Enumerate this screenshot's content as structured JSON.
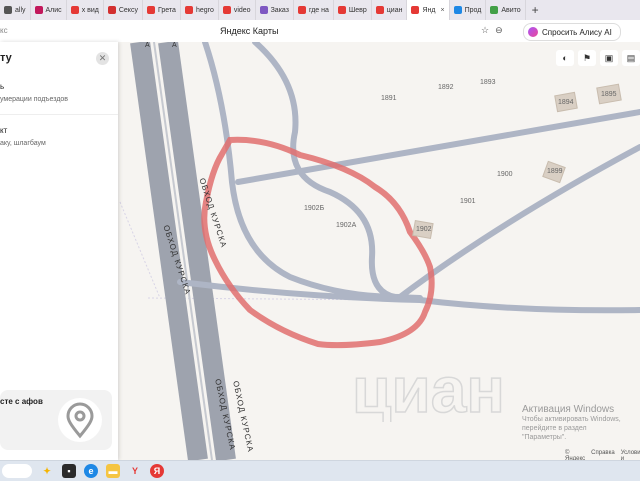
{
  "browser": {
    "tabs": [
      {
        "label": "ally",
        "icon": "app-icon",
        "color": "#555555"
      },
      {
        "label": "Алис",
        "icon": "k-icon",
        "color": "#c2185b"
      },
      {
        "label": "х вид",
        "icon": "yandex-icon",
        "color": "#e53935"
      },
      {
        "label": "Сексу",
        "icon": "x-icon",
        "color": "#d32f2f"
      },
      {
        "label": "Грета",
        "icon": "video-icon",
        "color": "#e53935"
      },
      {
        "label": "hegro",
        "icon": "yandex-icon",
        "color": "#e53935"
      },
      {
        "label": "video",
        "icon": "video-icon",
        "color": "#e53935"
      },
      {
        "label": "Заказ",
        "icon": "app-icon",
        "color": "#7e57c2"
      },
      {
        "label": "где на",
        "icon": "yandex-icon",
        "color": "#e53935"
      },
      {
        "label": "Шевр",
        "icon": "bookmark-icon",
        "color": "#e53935"
      },
      {
        "label": "циан",
        "icon": "yandex-icon",
        "color": "#e53935"
      },
      {
        "label": "Янд",
        "icon": "map-pin-icon",
        "color": "#e53935",
        "active": true
      },
      {
        "label": "Прод",
        "icon": "app-icon",
        "color": "#1e88e5"
      },
      {
        "label": "Авито",
        "icon": "avito-icon",
        "color": "#43a047"
      }
    ],
    "address_left": "кс",
    "page_title": "Яндекс Карты",
    "alisa_label": "Спросить Алису AI"
  },
  "panel": {
    "title": "ту",
    "item1_title": "ь",
    "item1_sub": "умерации подъездов",
    "item2_title": "кт",
    "item2_sub": "аку, шлагбаум",
    "promo_text": "сте с афов"
  },
  "map": {
    "road_labels": [
      "ОБХОД КУРСКА",
      "ОБХОД КУРСКА",
      "ОБХОД КУРСКА",
      "ОБХОД КУРСКА"
    ],
    "road_letter": "А",
    "house_numbers": [
      "1891",
      "1892",
      "1893",
      "1894",
      "1895",
      "1899",
      "1900",
      "1901",
      "1902",
      "1902Б",
      "1902А"
    ],
    "controls": [
      "layers-icon",
      "traffic-icon",
      "camera-icon",
      "bus-icon"
    ]
  },
  "watermark": {
    "title": "Активация Windows",
    "line1": "Чтобы активировать Windows, перейдите в раздел",
    "line2": "\"Параметры\"."
  },
  "attribution": {
    "brand": "© Яндекс",
    "help": "Справка",
    "terms": "Условия и"
  },
  "colors": {
    "road": "#aeb5c5",
    "highway": "#9ea3ae",
    "annotation": "#e06f6f",
    "map_bg": "#f6f4f1"
  }
}
